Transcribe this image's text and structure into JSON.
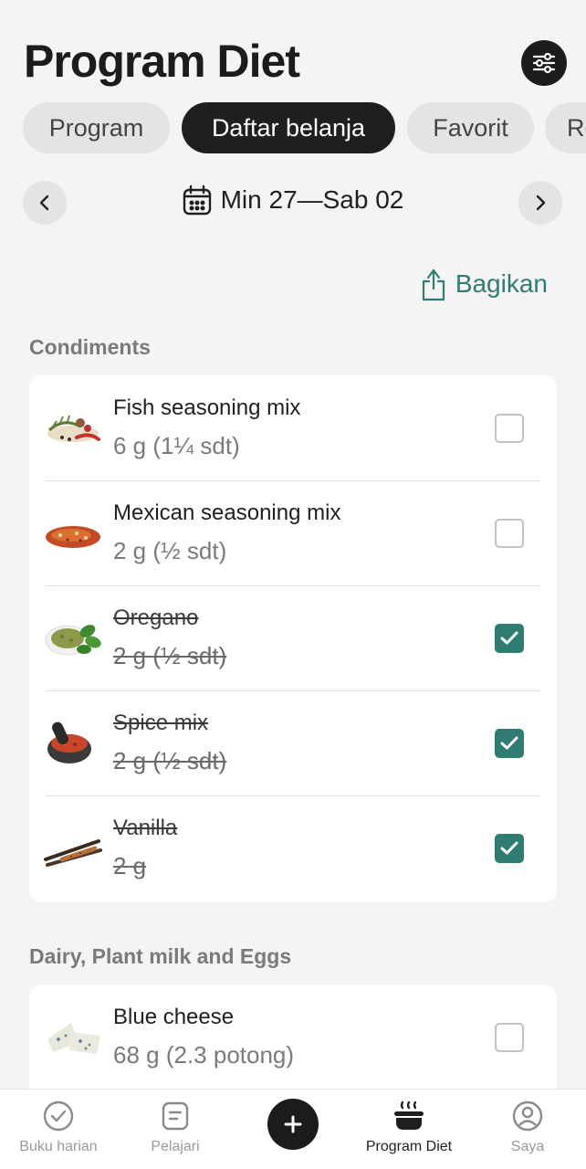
{
  "header": {
    "title": "Program Diet"
  },
  "tabs": [
    {
      "label": "Program"
    },
    {
      "label": "Daftar belanja"
    },
    {
      "label": "Favorit"
    },
    {
      "label": "Re"
    }
  ],
  "week": {
    "label": "Min 27—Sab 02"
  },
  "share": {
    "label": "Bagikan"
  },
  "sections": [
    {
      "title": "Condiments",
      "items": [
        {
          "name": "Fish seasoning mix",
          "qty": "6 g (1¼ sdt)",
          "checked": false
        },
        {
          "name": "Mexican seasoning mix",
          "qty": "2 g (½ sdt)",
          "checked": false
        },
        {
          "name": "Oregano",
          "qty": "2 g (½ sdt)",
          "checked": true
        },
        {
          "name": "Spice mix",
          "qty": "2 g (½ sdt)",
          "checked": true
        },
        {
          "name": "Vanilla",
          "qty": "2 g",
          "checked": true
        }
      ]
    },
    {
      "title": "Dairy, Plant milk and Eggs",
      "items": [
        {
          "name": "Blue cheese",
          "qty": "68 g (2.3 potong)",
          "checked": false
        }
      ]
    }
  ],
  "bottom_nav": [
    {
      "label": "Buku harian",
      "icon": "check-circle-icon"
    },
    {
      "label": "Pelajari",
      "icon": "document-icon"
    },
    {
      "label": "Program Diet",
      "icon": "cooking-pot-icon"
    },
    {
      "label": "Saya",
      "icon": "user-circle-icon"
    }
  ],
  "colors": {
    "accent": "#2f7d72",
    "dark": "#1c1c1c",
    "chip": "#e4e4e4"
  }
}
